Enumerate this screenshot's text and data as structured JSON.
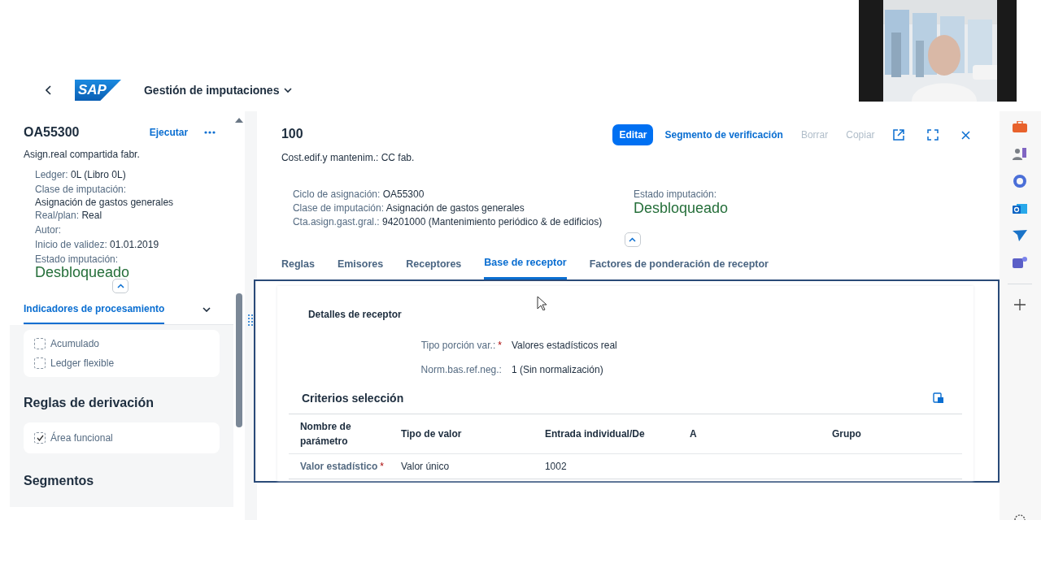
{
  "header": {
    "logo": "SAP",
    "title": "Gestión de imputaciones"
  },
  "left_panel": {
    "title": "OA55300",
    "action": "Ejecutar",
    "subtitle": "Asign.real compartida fabr.",
    "fields": [
      {
        "label": "Ledger:",
        "value": "0L (Libro 0L)",
        "kind": "inline"
      },
      {
        "label": "Clase de imputación:",
        "value": "Asignación de gastos generales",
        "kind": "stacked"
      },
      {
        "label": "Real/plan:",
        "value": "Real",
        "kind": "inline"
      },
      {
        "label": "Autor:",
        "kind": "inline"
      },
      {
        "label": "Inicio de validez:",
        "value": "01.01.2019",
        "kind": "inline"
      }
    ],
    "status_label": "Estado imputación:",
    "status": "Desbloqueado",
    "section_tab": {
      "label": "Indicadores de procesamiento",
      "expanded": false
    },
    "checkboxes": [
      {
        "label": "Acumulado",
        "checked": false
      },
      {
        "label": "Ledger flexible",
        "checked": false
      }
    ],
    "derivation": {
      "title": "Reglas de derivación",
      "checkboxes": [
        {
          "label": "Área funcional",
          "checked": true
        }
      ]
    },
    "segments_title": "Segmentos"
  },
  "main": {
    "title": "100",
    "subtitle": "Cost.edif.y mantenim.: CC fab.",
    "actions": [
      {
        "label": "Editar",
        "kind": "primary",
        "disabled": false
      },
      {
        "label": "Segmento de verificación",
        "kind": "link",
        "disabled": false
      },
      {
        "label": "Borrar",
        "kind": "link",
        "disabled": true
      },
      {
        "label": "Copiar",
        "kind": "link",
        "disabled": true
      }
    ],
    "fields": [
      {
        "label": "Ciclo de asignación:",
        "value": "OA55300"
      },
      {
        "label": "Clase de imputación:",
        "value": "Asignación de gastos generales"
      },
      {
        "label": "Cta.asign.gast.gral.:",
        "value": "94201000 (Mantenimiento periódico & de edificios)"
      }
    ],
    "status_label": "Estado imputación:",
    "status": "Desbloqueado",
    "tabs": [
      {
        "label": "Reglas",
        "selected": false
      },
      {
        "label": "Emisores",
        "selected": false
      },
      {
        "label": "Receptores",
        "selected": false
      },
      {
        "label": "Base de receptor",
        "selected": true
      },
      {
        "label": "Factores de ponderación de receptor",
        "selected": false
      }
    ],
    "receptor": {
      "title": "Detalles de receptor",
      "fields": [
        {
          "label": "Tipo porción var.:",
          "marker": "*",
          "value": "Valores estadísticos real"
        },
        {
          "label": "Norm.bas.ref.neg.:",
          "value": "1 (Sin normalización)"
        }
      ]
    },
    "criteria": {
      "title": "Criterios selección",
      "columns": [
        "Nombre de parámetro",
        "Tipo de valor",
        "Entrada individual/De",
        "A",
        "Grupo"
      ],
      "rows": [
        {
          "marker": "*",
          "cells": [
            "Valor estadístico",
            "Valor único",
            "1002"
          ]
        }
      ]
    }
  }
}
